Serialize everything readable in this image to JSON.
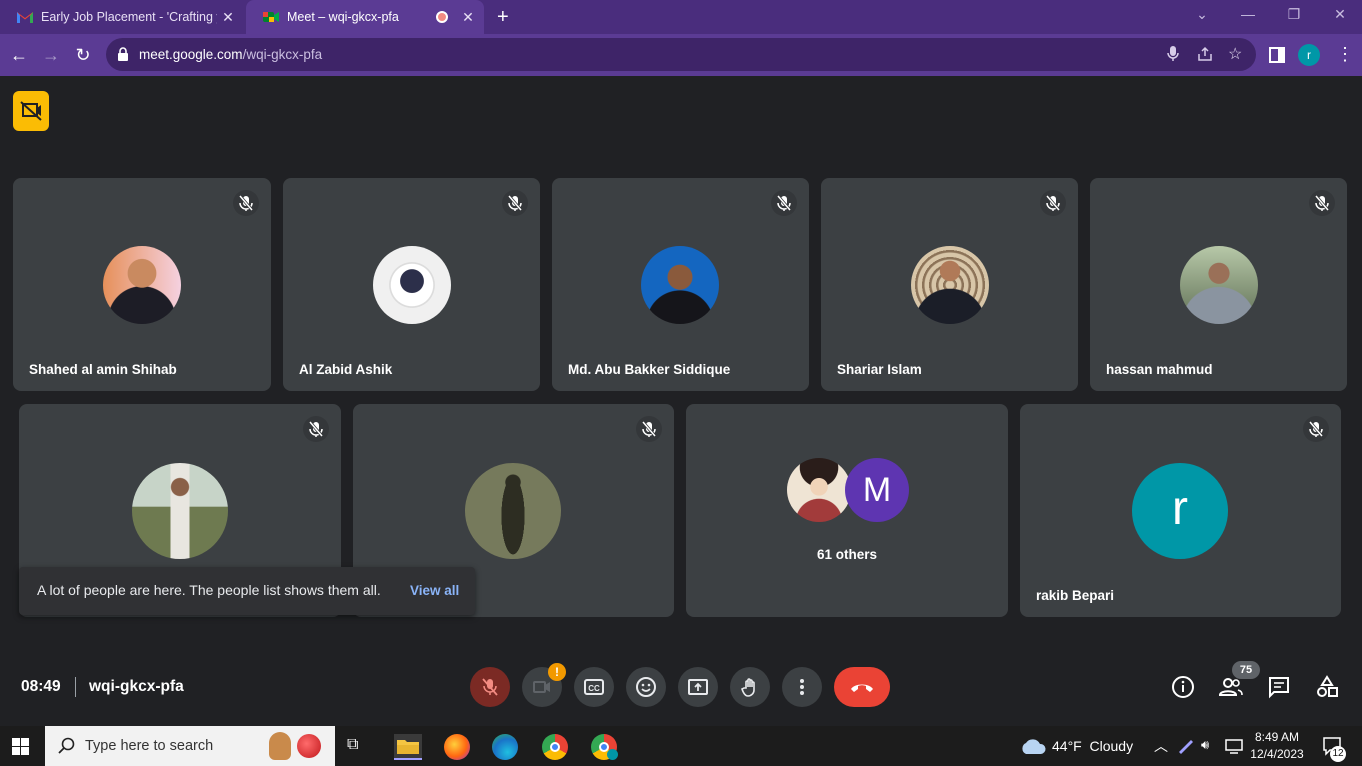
{
  "browser": {
    "tabs": [
      {
        "title": "Early Job Placement - 'Crafting y",
        "icon": "gmail-icon"
      },
      {
        "title": "Meet – wqi-gkcx-pfa",
        "icon": "meet-icon",
        "active": true
      }
    ],
    "url_host": "meet.google.com",
    "url_path": "/wqi-gkcx-pfa",
    "profile_initial": "r"
  },
  "meet": {
    "participants_row1": [
      {
        "name": "Shahed al amin Shihab",
        "muted": true
      },
      {
        "name": "Al Zabid Ashik",
        "muted": true
      },
      {
        "name": "Md. Abu Bakker Siddique",
        "muted": true
      },
      {
        "name": "Shariar Islam",
        "muted": true
      },
      {
        "name": "hassan mahmud",
        "muted": true
      }
    ],
    "participants_row2": [
      {
        "name": "",
        "muted": true
      },
      {
        "name": "",
        "muted": true
      },
      {
        "name": "61 others",
        "initial": "M"
      },
      {
        "name": "rakib Bepari",
        "initial": "r",
        "muted": true
      }
    ],
    "notice": {
      "text": "A lot of people are here. The people list shows them all.",
      "link": "View all"
    },
    "bottom": {
      "time": "08:49",
      "meeting_code": "wqi-gkcx-pfa",
      "people_count": "75",
      "camera_alert": "!"
    }
  },
  "taskbar": {
    "search_placeholder": "Type here to search",
    "weather": "44°F  Cloudy",
    "time": "8:49 AM",
    "date": "12/4/2023",
    "notifications": "12"
  },
  "colors": {
    "chrome_purple": "#5b3b94",
    "tile_bg": "#3c4043",
    "end_call": "#ea4335",
    "avatar_teal": "#0097a7",
    "avatar_purple": "#5e35b1"
  }
}
